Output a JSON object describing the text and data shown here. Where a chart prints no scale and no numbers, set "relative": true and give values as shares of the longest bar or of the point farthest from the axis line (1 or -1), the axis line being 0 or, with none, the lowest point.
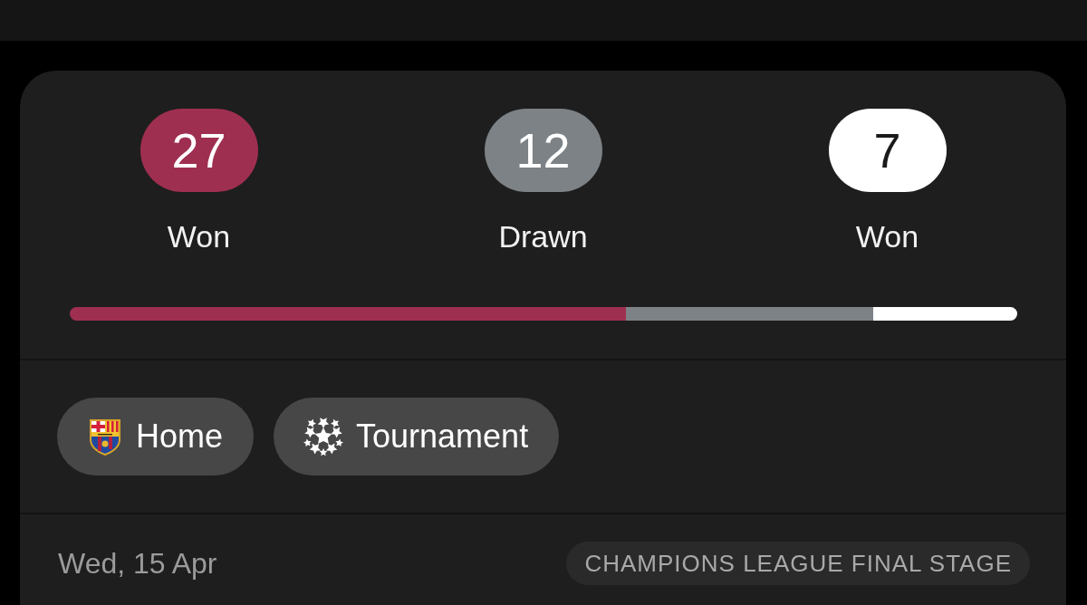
{
  "record": [
    {
      "count": "27",
      "label": "Won",
      "color": "#9f2f51"
    },
    {
      "count": "12",
      "label": "Drawn",
      "color": "#7c8286"
    },
    {
      "count": "7",
      "label": "Won",
      "color": "#ffffff"
    }
  ],
  "results_bar": {
    "chart_data": {
      "type": "bar",
      "orientation": "horizontal",
      "stacked": true,
      "relative": true,
      "series": [
        {
          "color": "#9f2f51",
          "values": [
            0.587
          ]
        },
        {
          "color": "#7c8286",
          "values": [
            0.261
          ]
        },
        {
          "color": "#ffffff",
          "values": [
            0.152
          ]
        }
      ]
    }
  },
  "filters": [
    {
      "kind": "crest",
      "label": "Home"
    },
    {
      "kind": "ball",
      "label": "Tournament"
    }
  ],
  "match": {
    "date": "Wed, 15 Apr",
    "competition": "CHAMPIONS LEAGUE FINAL STAGE"
  }
}
